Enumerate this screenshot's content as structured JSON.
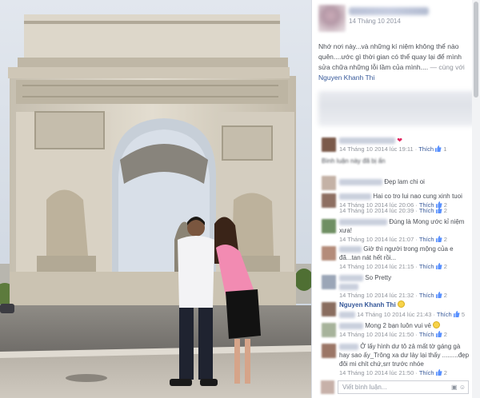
{
  "post": {
    "date": "14 Tháng 10 2014",
    "text": "Nhớ nơi này...và những kí niệm không thể nào quên....ước gì thời gian có thể quay lại để mình sửa chữa những lỗi lầm của mình....",
    "with_prefix": " — cùng với ",
    "tagged": "Nguyen Khanh Thi"
  },
  "comments": [
    {
      "author": "",
      "text": "",
      "time": "14 Tháng 10 2014 lúc 19:11",
      "like": "Thích",
      "likes": "1",
      "icon": "heart"
    },
    {
      "author": "",
      "text": "Bình luận này đã bị ẩn",
      "time": "",
      "like": "",
      "likes": "",
      "icon": ""
    },
    {
      "author": "",
      "text": "Đẹp lam chi oi",
      "time": "",
      "like": "",
      "likes": "",
      "icon": ""
    },
    {
      "author": "",
      "text": "Hai co tro lui nao cung xinh tuoi",
      "time": "14 Tháng 10 2014 lúc 20:06",
      "like": "Thích",
      "likes": "2",
      "icon": ""
    },
    {
      "author": "",
      "text": "",
      "time": "14 Tháng 10 2014 lúc 20:39",
      "like": "Thích",
      "likes": "2",
      "icon": ""
    },
    {
      "author": "",
      "text": "Đúng là Mong ước kỉ niệm xưa!",
      "time": "14 Tháng 10 2014 lúc 21:07",
      "like": "Thích",
      "likes": "2",
      "icon": ""
    },
    {
      "author": "",
      "text": "Giờ thì người trong mộng của e đã...tan nát hết rồi...",
      "time": "14 Tháng 10 2014 lúc 21:15",
      "like": "Thích",
      "likes": "2",
      "icon": ""
    },
    {
      "author": "",
      "text": "So Pretty",
      "time": "14 Tháng 10 2014 lúc 21:32",
      "like": "Thích",
      "likes": "2",
      "icon": ""
    },
    {
      "author": "Nguyen Khanh Thi",
      "text": "",
      "time": "14 Tháng 10 2014 lúc 21:43",
      "like": "Thích",
      "likes": "5",
      "icon": "smiley"
    },
    {
      "author": "",
      "text": "Mong 2 bạn luôn vui vẻ",
      "time": "14 Tháng 10 2014 lúc 21:50",
      "like": "Thích",
      "likes": "2",
      "icon": "smiley"
    },
    {
      "author": "",
      "text": "Ở lấy hình dư tô zả mất tờ gáng gà hay sao ấy_Trông xa dư lày lại thấy .........đẹp đôi mi chít chứ,srr trước nhóe",
      "time": "14 Tháng 10 2014 lúc 21:50",
      "like": "Thích",
      "likes": "2",
      "icon": ""
    }
  ],
  "reply": {
    "placeholder": "Viết bình luận..."
  },
  "colors": {
    "link": "#365899",
    "meta": "#90949c",
    "panel_bg": "#f6f7f9"
  }
}
